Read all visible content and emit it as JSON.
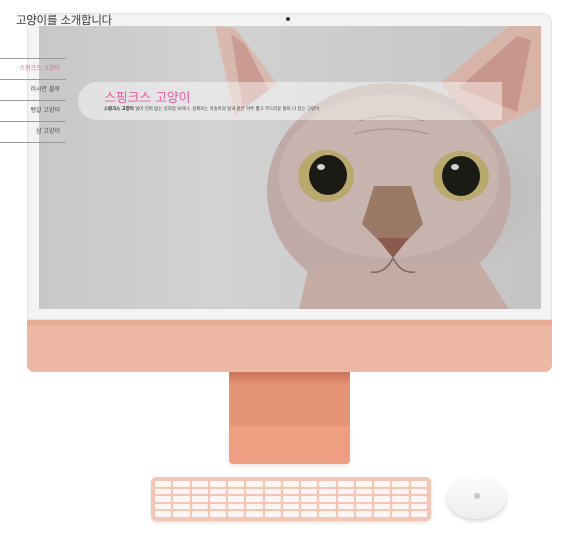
{
  "site": {
    "title": "고양이를 소개합니다"
  },
  "nav": {
    "items": [
      {
        "label": "스핑크스 고양이",
        "active": true
      },
      {
        "label": "러시안 블루",
        "active": false
      },
      {
        "label": "벵갈 고양이",
        "active": false
      },
      {
        "label": "샴 고양이",
        "active": false
      }
    ]
  },
  "hero": {
    "title": "스핑크스 고양이",
    "desc_bold": "스핑크스 고양이",
    "desc_text": "털이 전혀 없는 것처럼 보이나, 실제로는 복숭아의 털과 같은 아주 짧고 부드러운 털이 나 있는 고양이"
  },
  "colors": {
    "accent": "#e65aa3",
    "chassis": "#ecb7a3",
    "stand": "#e69478"
  },
  "icons": {
    "mouse_logo": "apple-logo-icon",
    "camera": "camera-dot-icon"
  }
}
